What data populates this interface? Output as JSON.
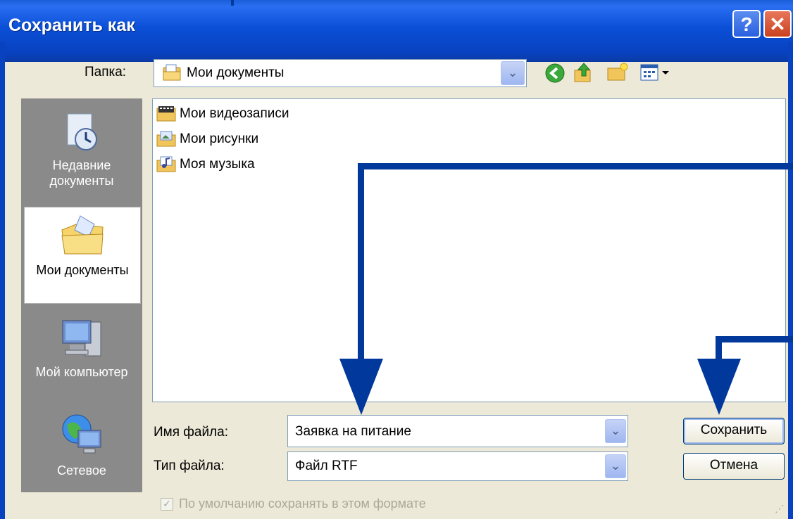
{
  "window": {
    "title": "Сохранить как",
    "help_glyph": "?",
    "close_glyph": "✕"
  },
  "folder": {
    "label": "Папка:",
    "value": "Мои документы"
  },
  "toolbar": {
    "icons": [
      "back-icon",
      "up-folder-icon",
      "new-folder-icon",
      "view-menu-icon"
    ]
  },
  "places": [
    {
      "label": "Недавние документы",
      "icon": "recent-documents-icon"
    },
    {
      "label": "Мои документы",
      "icon": "my-documents-icon",
      "selected": true
    },
    {
      "label": "Мой компьютер",
      "icon": "my-computer-icon"
    },
    {
      "label": "Сетевое",
      "icon": "network-icon"
    }
  ],
  "files": [
    {
      "name": "Мои видеозаписи",
      "icon": "video-folder-icon"
    },
    {
      "name": "Мои рисунки",
      "icon": "pictures-folder-icon"
    },
    {
      "name": "Моя музыка",
      "icon": "music-folder-icon"
    }
  ],
  "filename": {
    "label": "Имя файла:",
    "value": "Заявка на питание"
  },
  "filetype": {
    "label": "Тип файла:",
    "value": "Файл RTF"
  },
  "buttons": {
    "save": "Сохранить",
    "cancel": "Отмена"
  },
  "default_format": {
    "label": "По умолчанию сохранять в этом формате",
    "checked": true
  },
  "colors": {
    "title_bar": "#0842c0",
    "annotation_arrow": "#00389b",
    "dialog_bg": "#ece9d8"
  }
}
